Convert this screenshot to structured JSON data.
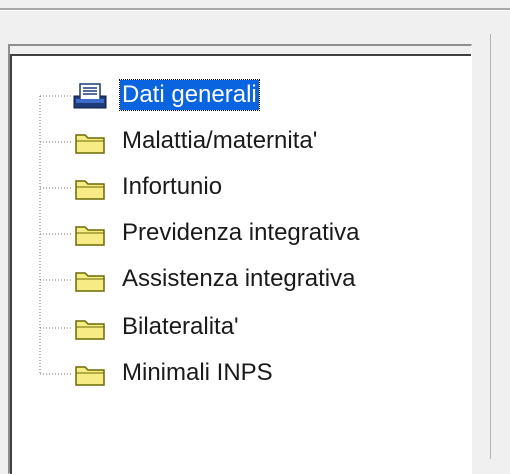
{
  "tree": {
    "items": [
      {
        "label": "Dati generali",
        "icon": "document-tray-icon",
        "selected": true
      },
      {
        "label": "Malattia/maternita'",
        "icon": "folder-icon",
        "selected": false
      },
      {
        "label": "Infortunio",
        "icon": "folder-icon",
        "selected": false
      },
      {
        "label": "Previdenza integrativa",
        "icon": "folder-icon",
        "selected": false
      },
      {
        "label": "Assistenza integrativa",
        "icon": "folder-icon",
        "selected": false
      },
      {
        "label": "Bilateralita'",
        "icon": "folder-icon",
        "selected": false
      },
      {
        "label": "Minimali INPS",
        "icon": "folder-icon",
        "selected": false
      }
    ]
  },
  "colors": {
    "selection": "#0a64e0",
    "folder_fill": "#f7eb86",
    "folder_outline": "#6b6b00"
  }
}
